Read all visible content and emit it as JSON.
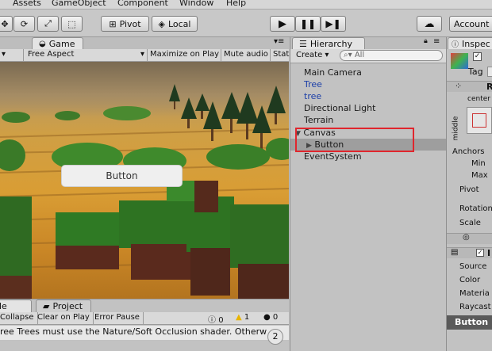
{
  "menu": [
    "Assets",
    "GameObject",
    "Component",
    "Window",
    "Help"
  ],
  "toolbar": {
    "pivot_label": "Pivot",
    "local_label": "Local",
    "account_label": "Account"
  },
  "game": {
    "tab_label": "Game",
    "aspect": "Free Aspect",
    "maximize_on_play": "Maximize on Play",
    "mute_audio": "Mute audio",
    "stats": "Stats",
    "ui_button_text": "Button"
  },
  "console": {
    "tab_left": "le",
    "tab_project": "Project",
    "collapse": "Collapse",
    "clear_on_play": "Clear on Play",
    "error_pause": "Error Pause",
    "count_log": "0",
    "count_warn": "1",
    "count_err": "0",
    "message": "ree Trees must use the Nature/Soft Occlusion shader. Otherw",
    "badge": "2"
  },
  "hierarchy": {
    "tab_label": "Hierarchy",
    "create_label": "Create",
    "search_placeholder": "All",
    "items": [
      {
        "label": "Main Camera"
      },
      {
        "label": "Tree"
      },
      {
        "label": "tree"
      },
      {
        "label": "Directional Light"
      },
      {
        "label": "Terrain"
      },
      {
        "label": "Canvas"
      },
      {
        "label": "Button"
      },
      {
        "label": "EventSystem"
      }
    ]
  },
  "inspector": {
    "tab_label": "Inspec",
    "tag_label": "Tag",
    "r_label": "R",
    "center_label": "center",
    "middle_label": "middle",
    "anchors_label": "Anchors",
    "min_label": "Min",
    "max_label": "Max",
    "pivot_label": "Pivot",
    "rotation_label": "Rotation",
    "scale_label": "Scale",
    "i_label": "I",
    "source_label": "Source",
    "color_label": "Color",
    "material_label": "Materia",
    "raycast_label": "Raycast",
    "button_label": "Button"
  }
}
